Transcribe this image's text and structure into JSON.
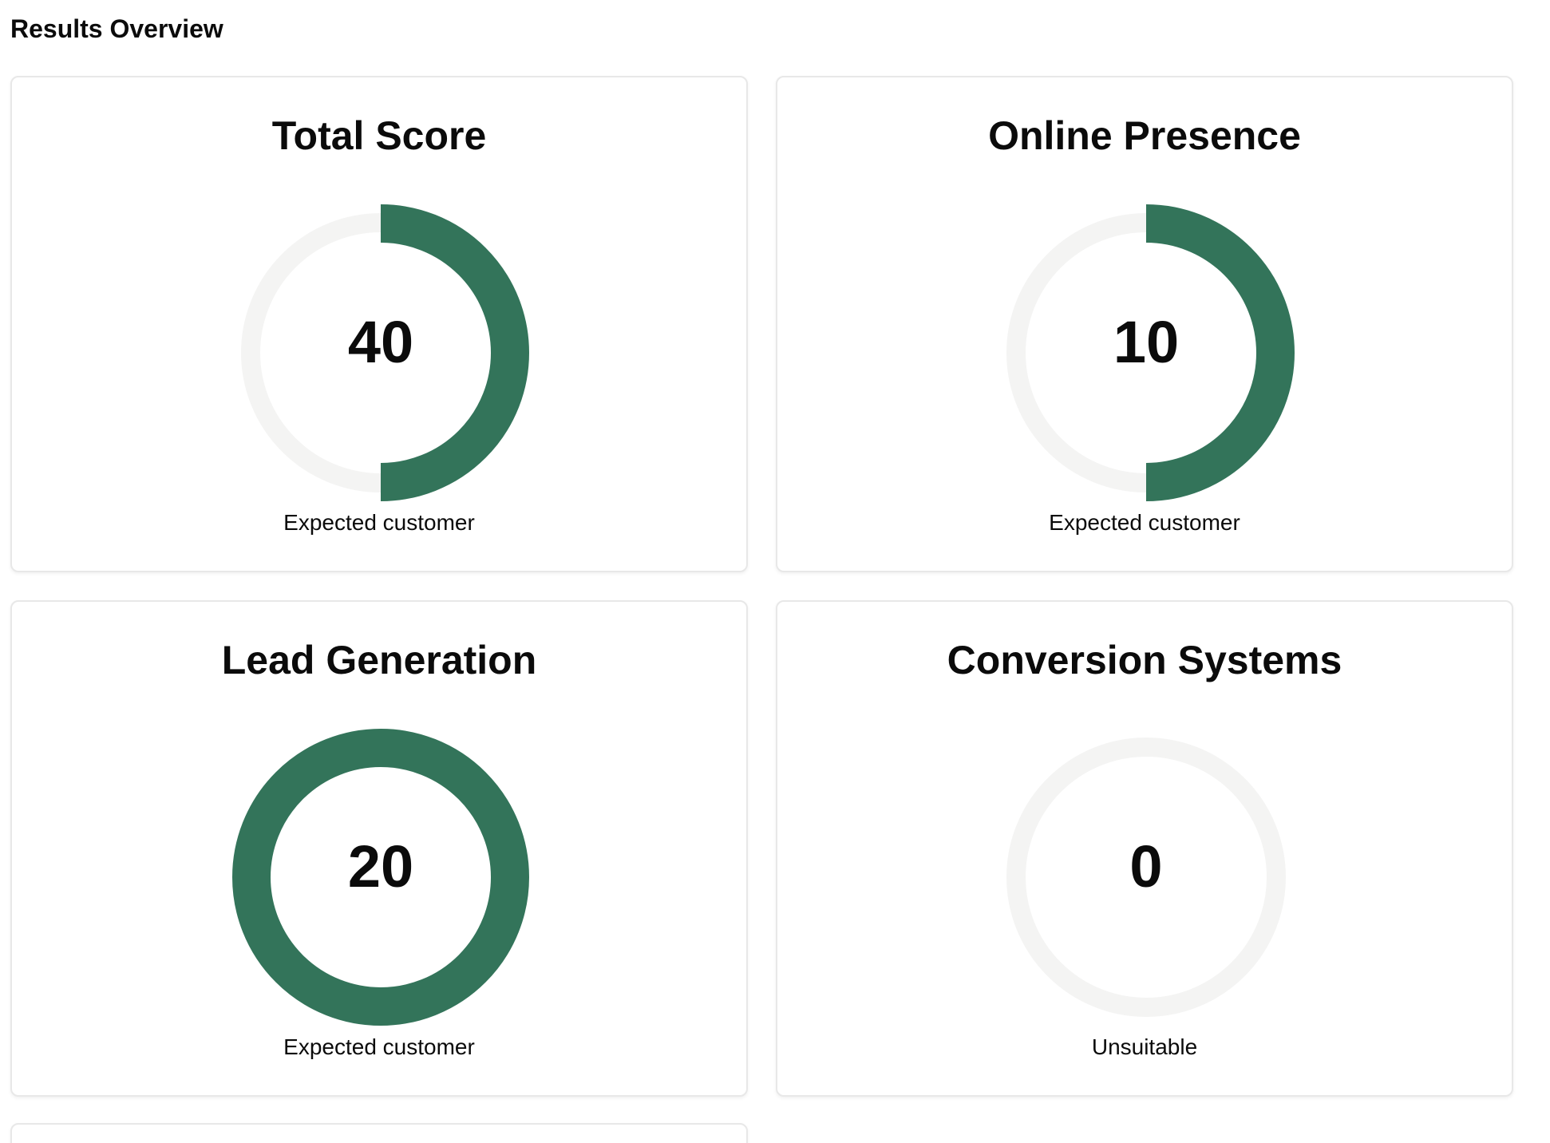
{
  "page": {
    "title": "Results Overview"
  },
  "colors": {
    "accent": "#33745a",
    "track": "#f4f4f3"
  },
  "cards": [
    {
      "title": "Total Score",
      "value": "40",
      "progress": 0.5,
      "status": "Expected customer"
    },
    {
      "title": "Online Presence",
      "value": "10",
      "progress": 0.5,
      "status": "Expected customer"
    },
    {
      "title": "Lead Generation",
      "value": "20",
      "progress": 1.0,
      "status": "Expected customer"
    },
    {
      "title": "Conversion Systems",
      "value": "0",
      "progress": 0,
      "status": "Unsuitable"
    }
  ]
}
